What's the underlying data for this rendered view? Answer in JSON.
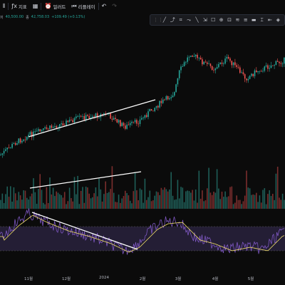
{
  "toolbar": {
    "items": [
      {
        "icon": "candles-icon",
        "label": ""
      },
      {
        "icon": "indicators-icon",
        "label": "지표"
      },
      {
        "icon": "layout-icon",
        "label": ""
      },
      {
        "icon": "alert-icon",
        "label": "얼러트"
      },
      {
        "icon": "replay-icon",
        "label": "리플레이"
      },
      {
        "icon": "undo-icon",
        "label": "↶"
      },
      {
        "icon": "redo-icon",
        "label": "↷"
      }
    ]
  },
  "ohlc": {
    "open_label": "저",
    "open_value": "40,500.00",
    "close_label": "종",
    "close_value": "42,758.03",
    "change": "+109.49 (+0.13%)"
  },
  "draw_tools": [
    "⋮⋮",
    "╱",
    "⤴",
    "⌗",
    "⤳",
    "╲",
    "⇲",
    "☐",
    "⊕",
    "⊡",
    "≋",
    "≡",
    "▬",
    "⌶",
    "⇤",
    "◈"
  ],
  "axis": {
    "labels": [
      "11월",
      "12월",
      "2024",
      "2월",
      "3월",
      "4월",
      "5월"
    ]
  },
  "colors": {
    "up": "#26a69a",
    "down": "#ef5350",
    "rsi_line": "#7e57c2",
    "rsi_ma": "#f5e26b",
    "band": "#2a2340",
    "trendline": "#ffffff"
  }
}
